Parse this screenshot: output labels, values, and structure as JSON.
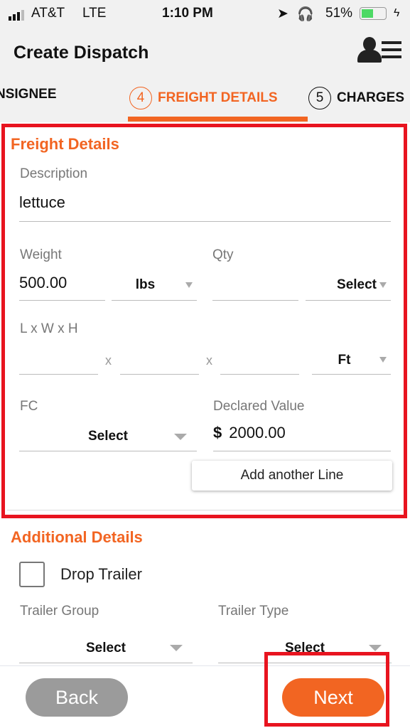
{
  "status": {
    "carrier": "AT&T",
    "network": "LTE",
    "time": "1:10 PM",
    "battery": "51%"
  },
  "header": {
    "title": "Create Dispatch",
    "icon": "user-list-icon"
  },
  "tabs": [
    {
      "label": "NSIGNEE"
    },
    {
      "number": "4",
      "label": "FREIGHT DETAILS",
      "active": true
    },
    {
      "number": "5",
      "label": "CHARGES"
    }
  ],
  "freight": {
    "title": "Freight Details",
    "description_label": "Description",
    "description_value": "lettuce",
    "weight_label": "Weight",
    "weight_value": "500.00",
    "weight_unit": "lbs",
    "qty_label": "Qty",
    "qty_value": "",
    "qty_unit": "Select",
    "dims_label": "L x W x H",
    "dims_sep": "x",
    "dims_unit": "Ft",
    "fc_label": "FC",
    "fc_value": "Select",
    "declared_label": "Declared Value",
    "currency": "$",
    "declared_value": "2000.00",
    "add_line": "Add another Line"
  },
  "additional": {
    "title": "Additional Details",
    "drop_trailer": "Drop Trailer",
    "drop_trailer_checked": false,
    "trailer_group_label": "Trailer Group",
    "trailer_group_value": "Select",
    "trailer_type_label": "Trailer Type",
    "trailer_type_value": "Select"
  },
  "footer": {
    "back": "Back",
    "next": "Next"
  },
  "colors": {
    "accent": "#f26522",
    "annotation": "#e8141f",
    "back": "#9b9b9b"
  }
}
